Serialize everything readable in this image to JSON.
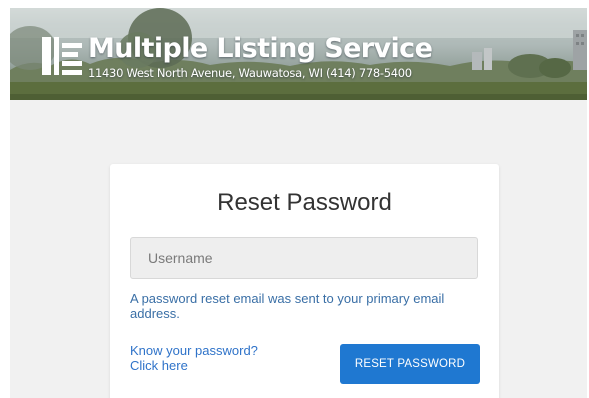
{
  "banner": {
    "title": "Multiple Listing Service",
    "address": "11430 West North Avenue, Wauwatosa, WI   (414) 778-5400"
  },
  "reset_form": {
    "title": "Reset Password",
    "username_placeholder": "Username",
    "message": "A password reset email was sent to your primary email address.",
    "know_password_line1": "Know your password?",
    "know_password_line2": "Click here",
    "reset_button_label": "RESET PASSWORD"
  },
  "colors": {
    "accent": "#1f78d1",
    "link": "#2f73c9",
    "message_text": "#3a6fa6",
    "page_background": "#f1f1f1"
  }
}
